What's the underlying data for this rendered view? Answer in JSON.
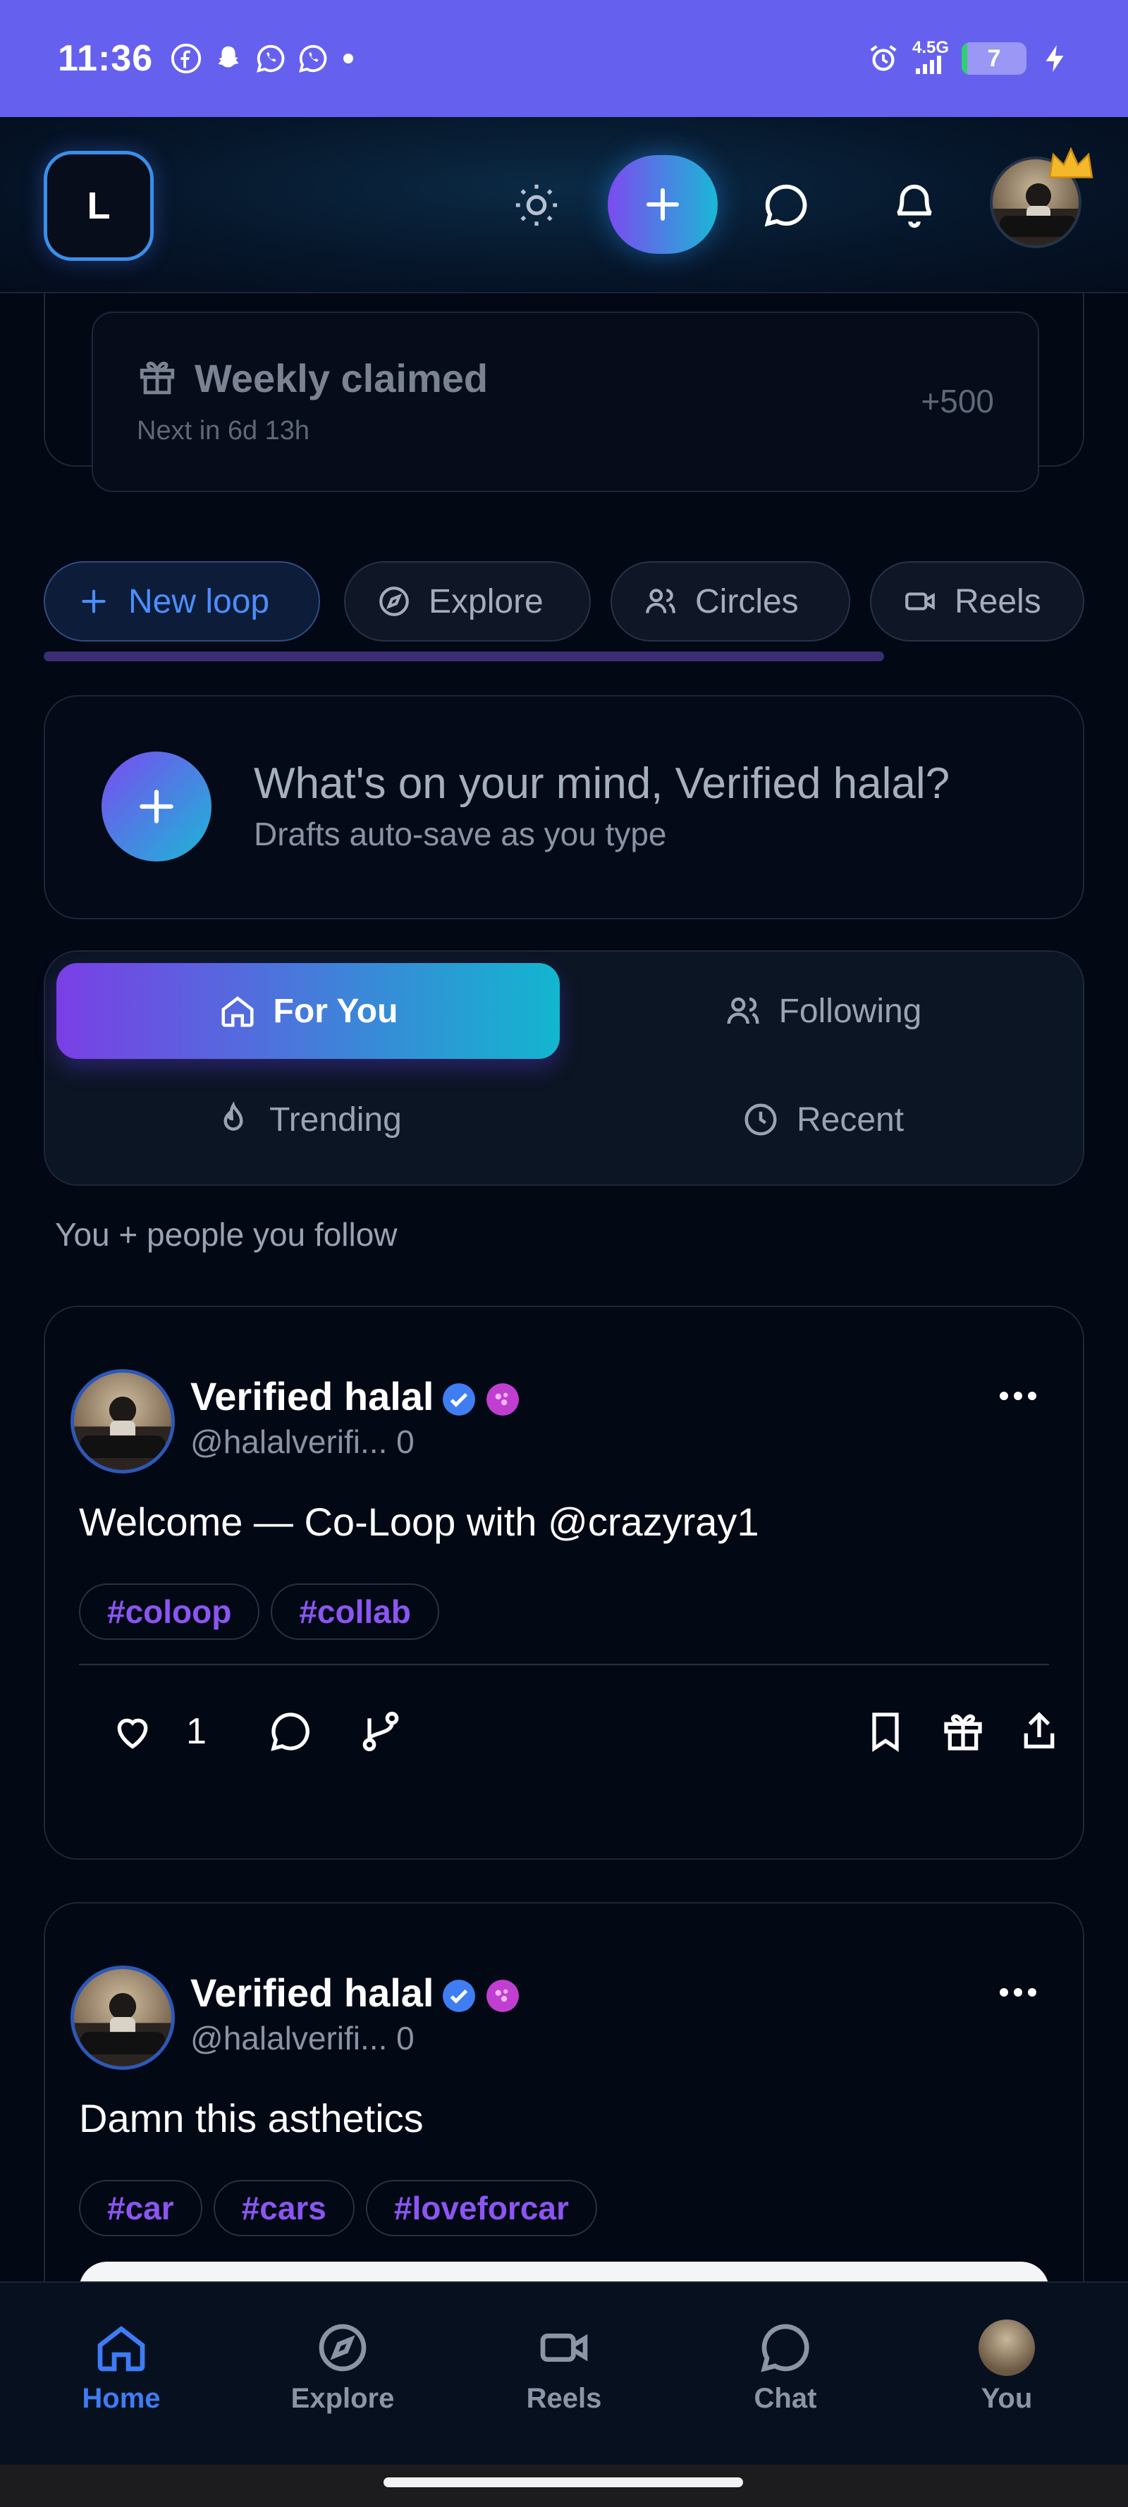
{
  "status_bar": {
    "time": "11:36",
    "network": "4.5G",
    "battery": "7",
    "notification_icons": [
      "facebook-icon",
      "snapchat-icon",
      "whatsapp-icon",
      "whatsapp-icon"
    ]
  },
  "header": {
    "logo_letter": "L",
    "icons": [
      "sun-icon",
      "plus-icon",
      "chat-bubble-icon",
      "bell-icon"
    ],
    "accent_gradient": [
      "#7b4bf0",
      "#1bb7d6"
    ]
  },
  "claim_card": {
    "title": "Weekly claimed",
    "subtitle": "Next in 6d 13h",
    "points": "+500"
  },
  "quick_actions": [
    {
      "label": "New loop",
      "icon": "plus-icon"
    },
    {
      "label": "Explore",
      "icon": "compass-icon"
    },
    {
      "label": "Circles",
      "icon": "users-icon"
    },
    {
      "label": "Reels",
      "icon": "video-icon"
    }
  ],
  "composer": {
    "prompt": "What's on your mind, Verified halal?",
    "hint": "Drafts auto-save as you type"
  },
  "feed_tabs": [
    {
      "label": "For You",
      "icon": "home-icon",
      "active": true
    },
    {
      "label": "Following",
      "icon": "users-icon",
      "active": false
    },
    {
      "label": "Trending",
      "icon": "flame-icon",
      "active": false
    },
    {
      "label": "Recent",
      "icon": "clock-icon",
      "active": false
    }
  ],
  "feed_note": "You + people you follow",
  "posts": [
    {
      "author": "Verified halal",
      "handle": "@halalverifi... 0",
      "text": "Welcome — Co-Loop with @crazyray1",
      "tags": [
        "#coloop",
        "#collab"
      ],
      "likes": "1"
    },
    {
      "author": "Verified halal",
      "handle": "@halalverifi... 0",
      "text": "Damn this asthetics",
      "tags": [
        "#car",
        "#cars",
        "#loveforcar"
      ]
    }
  ],
  "bottom_nav": [
    {
      "label": "Home",
      "icon": "home-icon",
      "active": true
    },
    {
      "label": "Explore",
      "icon": "compass-icon",
      "active": false
    },
    {
      "label": "Reels",
      "icon": "video-icon",
      "active": false
    },
    {
      "label": "Chat",
      "icon": "chat-bubble-icon",
      "active": false
    },
    {
      "label": "You",
      "icon": "avatar",
      "active": false
    }
  ]
}
